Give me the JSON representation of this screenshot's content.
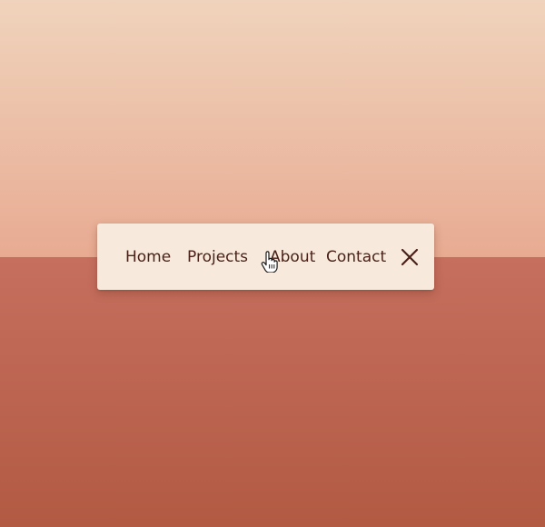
{
  "background": {
    "top_color": "#e8ab92",
    "bottom_color": "#c46a57"
  },
  "nav": {
    "background_color": "#f7eadd",
    "text_color": "#4a2118",
    "items": [
      {
        "label": "Home"
      },
      {
        "label": "Projects"
      },
      {
        "label": "About"
      },
      {
        "label": "Contact"
      }
    ],
    "close_icon": "close-icon"
  },
  "cursor": {
    "icon": "hand-pointer-icon"
  }
}
